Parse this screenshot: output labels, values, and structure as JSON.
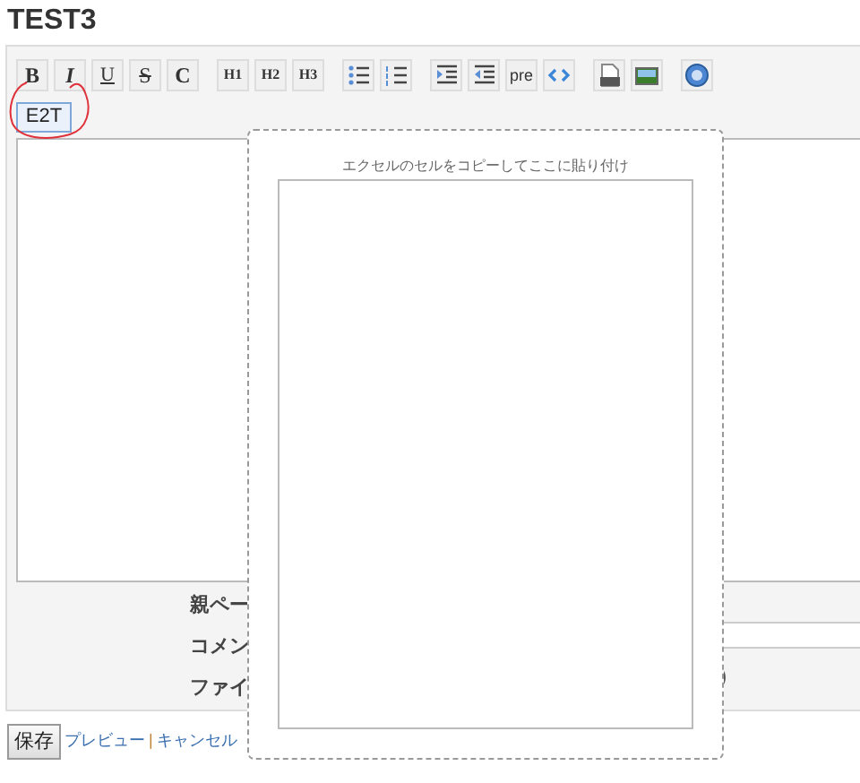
{
  "page_title": "TEST3",
  "toolbar": [
    [
      {
        "kind": "bold",
        "label": "B"
      },
      {
        "kind": "italic",
        "label": "I"
      },
      {
        "kind": "underline",
        "label": "U"
      },
      {
        "kind": "strike",
        "label": "S"
      },
      {
        "kind": "plain",
        "label": "C"
      }
    ],
    [
      {
        "kind": "heading",
        "label": "H1"
      },
      {
        "kind": "heading",
        "label": "H2"
      },
      {
        "kind": "heading",
        "label": "H3"
      }
    ],
    [
      {
        "kind": "bullets"
      },
      {
        "kind": "numbers"
      }
    ],
    [
      {
        "kind": "indent"
      },
      {
        "kind": "outdent"
      },
      {
        "kind": "mono",
        "label": "pre"
      },
      {
        "kind": "code"
      }
    ],
    [
      {
        "kind": "attachment"
      },
      {
        "kind": "image"
      }
    ],
    [
      {
        "kind": "help"
      }
    ]
  ],
  "e2t_button": "E2T",
  "form_labels": [
    "親ペー",
    "コメン",
    "ファイ"
  ],
  "file_hint_tail": ")",
  "save_button": "保存",
  "links": [
    "プレビュー",
    "キャンセル"
  ],
  "link_separator": "|",
  "paste_dialog": {
    "instruction": "エクセルのセルをコピーしてここに貼り付け"
  }
}
